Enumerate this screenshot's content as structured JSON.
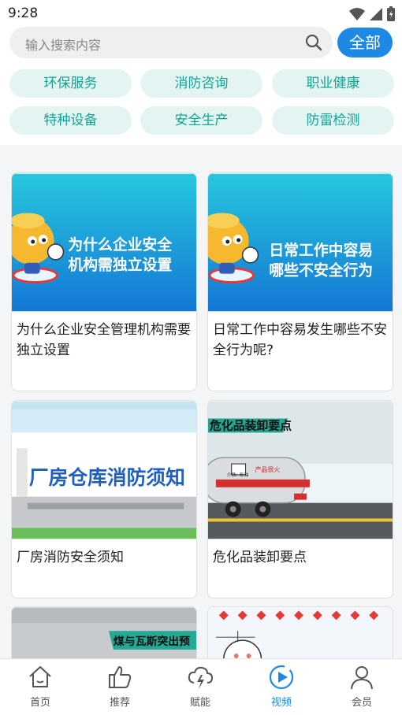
{
  "status": {
    "time": "9:28"
  },
  "search": {
    "placeholder": "输入搜索内容",
    "all_label": "全部"
  },
  "tags": [
    "环保服务",
    "消防咨询",
    "职业健康",
    "特种设备",
    "安全生产",
    "防雷检测"
  ],
  "cards": [
    {
      "title": "为什么企业安全管理机构需要独立设置",
      "thumb_text_1": "为什么企业安全",
      "thumb_text_2": "机构需独立设置"
    },
    {
      "title": "日常工作中容易发生哪些不安全行为呢?",
      "thumb_text_1": "日常工作中容易",
      "thumb_text_2": "哪些不安全行为"
    },
    {
      "title": "厂房消防安全须知",
      "thumb_text_1": "厂房仓库消防须知"
    },
    {
      "title": "危化品装卸要点",
      "thumb_text_1": "危化品装卸要点",
      "thumb_text_2": "产品很火",
      "thumb_text_3": "介质: 柴油"
    },
    {
      "title": "",
      "thumb_text_1": "煤与瓦斯突出预"
    },
    {
      "title": ""
    }
  ],
  "tabbar": {
    "items": [
      {
        "label": "首页",
        "icon": "home-icon"
      },
      {
        "label": "推荐",
        "icon": "thumbs-up-icon"
      },
      {
        "label": "赋能",
        "icon": "lightning-cloud-icon"
      },
      {
        "label": "视频",
        "icon": "play-circle-icon",
        "active": true
      },
      {
        "label": "会员",
        "icon": "person-icon"
      }
    ]
  },
  "colors": {
    "accent": "#1e88e5",
    "tag_bg": "#e3f4f2",
    "tag_text": "#12a597"
  }
}
